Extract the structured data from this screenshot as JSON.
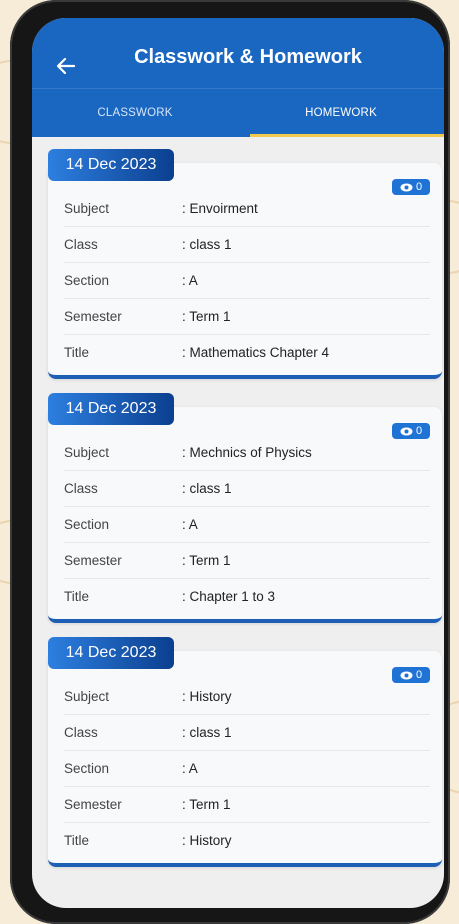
{
  "header": {
    "title": "Classwork & Homework"
  },
  "tabs": [
    {
      "label": "CLASSWORK"
    },
    {
      "label": "HOMEWORK",
      "active": true
    }
  ],
  "labels": {
    "subject": "Subject",
    "class": "Class",
    "section": "Section",
    "semester": "Semester",
    "title": "Title"
  },
  "items": [
    {
      "date": "14 Dec 2023",
      "views": "0",
      "subject": ": Envoirment",
      "class": ": class 1",
      "section": ": A",
      "semester": ": Term 1",
      "title": ": Mathematics Chapter 4"
    },
    {
      "date": "14 Dec 2023",
      "views": "0",
      "subject": ": Mechnics of Physics",
      "class": ": class 1",
      "section": ": A",
      "semester": ": Term 1",
      "title": ": Chapter 1 to 3"
    },
    {
      "date": "14 Dec 2023",
      "views": "0",
      "subject": ": History",
      "class": ": class 1",
      "section": ": A",
      "semester": ": Term 1",
      "title": ": History"
    }
  ],
  "colors": {
    "primary": "#1a67c1",
    "indicator": "#f2c94c"
  }
}
